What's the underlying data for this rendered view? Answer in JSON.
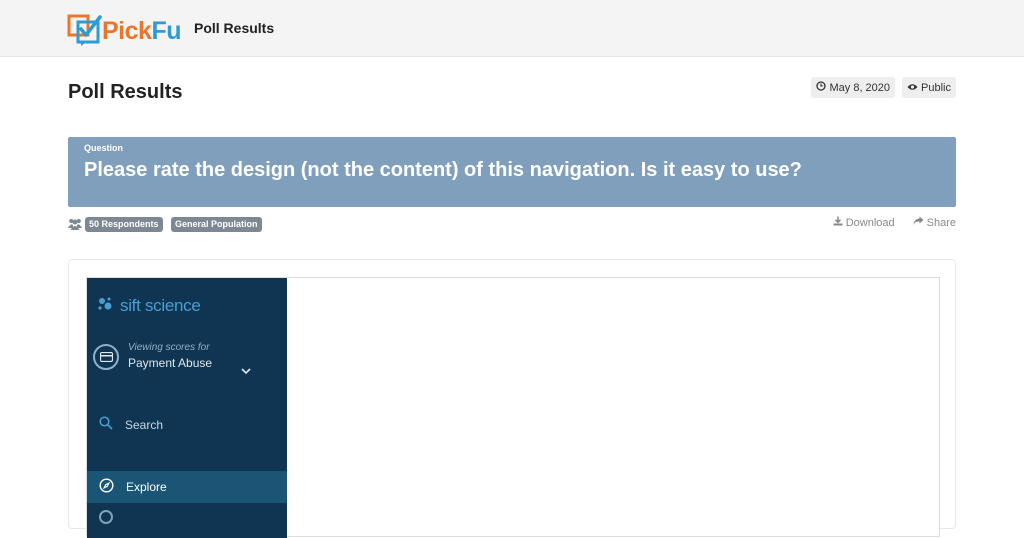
{
  "brand": {
    "pick": "Pick",
    "fu": "Fu"
  },
  "header": {
    "title": "Poll Results"
  },
  "page": {
    "title": "Poll Results",
    "date": "May 8, 2020",
    "visibility": "Public"
  },
  "question": {
    "label": "Question",
    "text": "Please rate the design (not the content) of this navigation. Is it easy to use?"
  },
  "info": {
    "respondents": "50 Respondents",
    "audience": "General Population",
    "download_label": "Download",
    "share_label": "Share"
  },
  "preview": {
    "brand": "sift science",
    "viewing_label": "Viewing scores for",
    "viewing_value": "Payment Abuse",
    "search_label": "Search",
    "explore_label": "Explore"
  },
  "colors": {
    "topbar_bg": "#f4f4f4",
    "question_bg": "#809fbd",
    "tag_bg": "#7d8893",
    "nav_bg": "#0f3552",
    "nav_active": "#1b5575",
    "brand_orange": "#e8772e",
    "brand_blue": "#2d9bd5"
  },
  "icons": [
    "pickfu-logo-icon",
    "clock-icon",
    "eye-icon",
    "users-icon",
    "download-icon",
    "share-icon",
    "sift-dots-icon",
    "credit-card-icon",
    "chevron-down-icon",
    "search-icon",
    "compass-icon"
  ]
}
